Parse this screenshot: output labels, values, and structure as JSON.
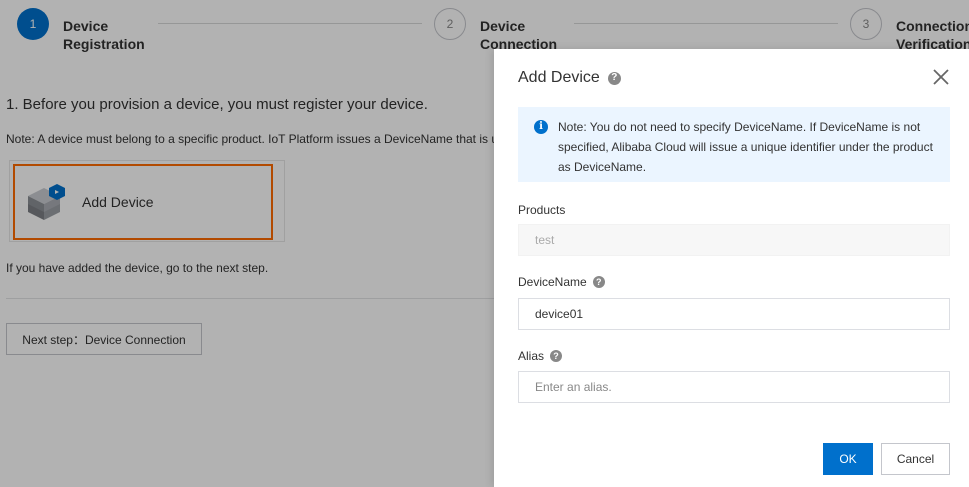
{
  "steps": [
    {
      "number": "1",
      "label": "Device\nRegistration",
      "active": true
    },
    {
      "number": "2",
      "label": "Device\nConnection",
      "active": false
    },
    {
      "number": "3",
      "label": "Connection\nVerification",
      "active": false
    }
  ],
  "main": {
    "heading": "1. Before you provision a device, you must register your device.",
    "note": "Note: A device must belong to a specific product. IoT Platform issues a DeviceName that is unique within the product.",
    "add_device_label": "Add Device",
    "hint": "If you have added the device, go to the next step.",
    "next_button": "Next step：Device Connection"
  },
  "drawer": {
    "title": "Add Device",
    "info_text": "Note: You do not need to specify DeviceName. If DeviceName is not specified, Alibaba Cloud will issue a unique identifier under the product as DeviceName.",
    "products_label": "Products",
    "products_value": "test",
    "devicename_label": "DeviceName",
    "devicename_value": "device01",
    "alias_label": "Alias",
    "alias_placeholder": "Enter an alias.",
    "ok_label": "OK",
    "cancel_label": "Cancel"
  },
  "icons": {
    "help": "?",
    "info": "i"
  },
  "colors": {
    "primary": "#0070cc",
    "highlight": "#ff6a00",
    "info_bg": "#ebf5ff"
  }
}
